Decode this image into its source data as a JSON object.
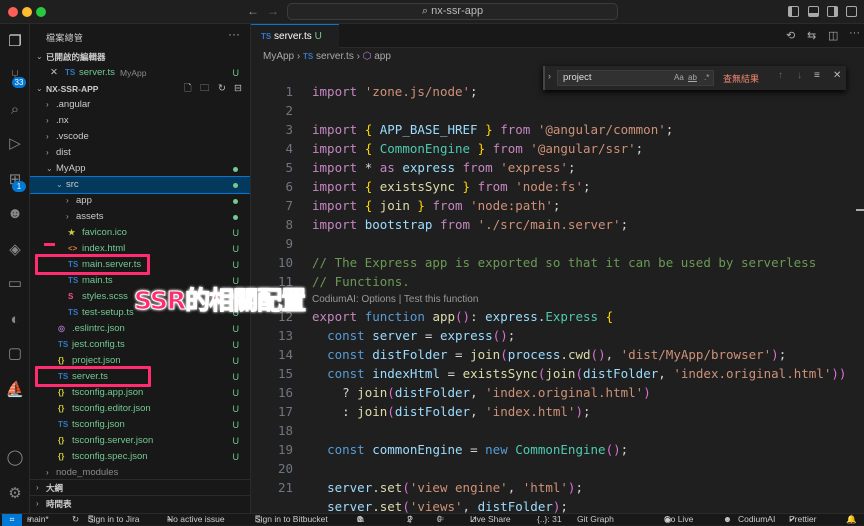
{
  "window": {
    "command_center": "nx-ssr-app"
  },
  "activity": {
    "scm_badge": "33",
    "ext_badge": "1"
  },
  "sidebar": {
    "title": "檔案總管",
    "open_editors": "已開啟的編輯器",
    "open_file": {
      "icon": "TS",
      "name": "server.ts",
      "folder": "MyApp",
      "status": "U"
    },
    "project": "NX-SSR-APP",
    "items": [
      {
        "label": ".angular",
        "icon": "",
        "status": ""
      },
      {
        "label": ".nx",
        "icon": "",
        "status": ""
      },
      {
        "label": ".vscode",
        "icon": "",
        "status": ""
      },
      {
        "label": "dist",
        "icon": "",
        "status": ""
      },
      {
        "label": "MyApp",
        "icon": "",
        "status": "dot"
      },
      {
        "label": "src",
        "icon": "",
        "status": "dot"
      },
      {
        "label": "app",
        "icon": "",
        "status": "dot"
      },
      {
        "label": "assets",
        "icon": "",
        "status": "dot"
      },
      {
        "label": "favicon.ico",
        "icon": "★",
        "status": "U"
      },
      {
        "label": "index.html",
        "icon": "<>",
        "status": "U"
      },
      {
        "label": "main.server.ts",
        "icon": "TS",
        "status": "U"
      },
      {
        "label": "main.ts",
        "icon": "TS",
        "status": "U"
      },
      {
        "label": "styles.scss",
        "icon": "S",
        "status": "U"
      },
      {
        "label": "test-setup.ts",
        "icon": "TS",
        "status": "U"
      },
      {
        "label": ".eslintrc.json",
        "icon": "◎",
        "status": "U"
      },
      {
        "label": "jest.config.ts",
        "icon": "TS",
        "status": "U"
      },
      {
        "label": "project.json",
        "icon": "{}",
        "status": "U"
      },
      {
        "label": "server.ts",
        "icon": "TS",
        "status": "U"
      },
      {
        "label": "tsconfig.app.json",
        "icon": "{}",
        "status": "U"
      },
      {
        "label": "tsconfig.editor.json",
        "icon": "{}",
        "status": "U"
      },
      {
        "label": "tsconfig.json",
        "icon": "TS",
        "status": "U"
      },
      {
        "label": "tsconfig.server.json",
        "icon": "{}",
        "status": "U"
      },
      {
        "label": "tsconfig.spec.json",
        "icon": "{}",
        "status": "U"
      },
      {
        "label": "node_modules",
        "icon": "",
        "status": ""
      }
    ],
    "outline": "大綱",
    "timeline": "時間表"
  },
  "editor": {
    "tab": {
      "icon": "TS",
      "name": "server.ts",
      "status": "U"
    },
    "breadcrumb": [
      "MyApp",
      "server.ts",
      "app"
    ],
    "breadcrumb_ts": "TS",
    "find": {
      "query": "project",
      "aa": "Aa",
      "ab": "ab",
      "regex": ".*",
      "result": "查無結果"
    },
    "codelens": "CodiumAI: Options | Test this function",
    "line_numbers": [
      "1",
      "2",
      "3",
      "4",
      "5",
      "6",
      "7",
      "8",
      "9",
      "10",
      "",
      "11",
      "12",
      "13",
      "14",
      "15",
      "16",
      "17",
      "18",
      "19",
      "20",
      "21"
    ],
    "lines": [
      "import 'zone.js/node';",
      "",
      "import { APP_BASE_HREF } from '@angular/common';",
      "import { CommonEngine } from '@angular/ssr';",
      "import * as express from 'express';",
      "import { existsSync } from 'node:fs';",
      "import { join } from 'node:path';",
      "import bootstrap from './src/main.server';",
      "",
      "// The Express app is exported so that it can be used by serverless",
      "// Functions.",
      "export function app(): express.Express {",
      "  const server = express();",
      "  const distFolder = join(process.cwd(), 'dist/MyApp/browser');",
      "  const indexHtml = existsSync(join(distFolder, 'index.original.html'))",
      "    ? join(distFolder, 'index.original.html')",
      "    : join(distFolder, 'index.html');",
      "",
      "  const commonEngine = new CommonEngine();",
      "",
      "  server.set('view engine', 'html');",
      "  server.set('views', distFolder);"
    ]
  },
  "annotation": "SSR的相關配置",
  "status": {
    "branch": "main*",
    "jira": "Sign in to Jira",
    "issue": "No active issue",
    "bitbucket": "Sign in to Bitbucket",
    "errors": "0",
    "warnings": "0",
    "ports": "2",
    "info": "0",
    "liveshare": "Live Share",
    "lines": "{..}: 31",
    "gitgraph": "Git Graph",
    "golive": "Go Live",
    "codium": "CodiumAI",
    "prettier": "Prettier"
  }
}
